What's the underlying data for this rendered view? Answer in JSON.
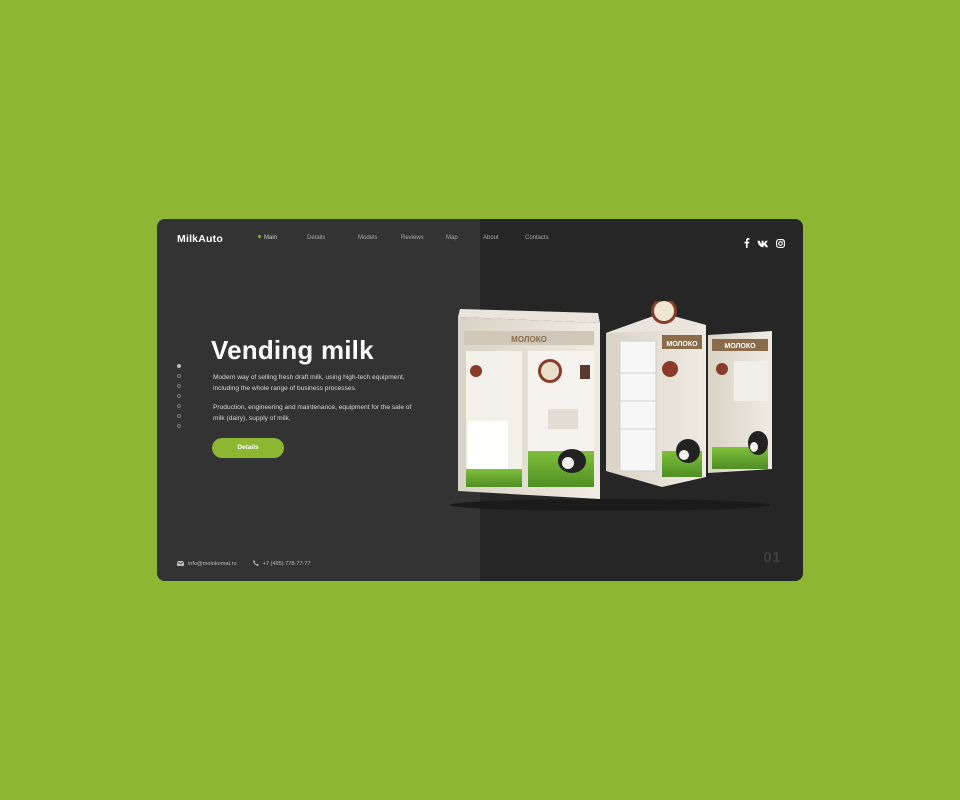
{
  "brand": {
    "logo": "MilkAuto"
  },
  "nav": {
    "items": [
      {
        "label": "Main",
        "active": true
      },
      {
        "label": "Details"
      },
      {
        "label": "Models"
      },
      {
        "label": "Reviews"
      },
      {
        "label": "Map"
      },
      {
        "label": "About"
      },
      {
        "label": "Contacts"
      }
    ]
  },
  "social": {
    "icons": [
      "facebook-icon",
      "vk-icon",
      "instagram-icon"
    ]
  },
  "slider": {
    "dot_count": 7,
    "active_index": 0,
    "current": "01"
  },
  "hero": {
    "title": "Vending milk",
    "paragraph1": "Modern way of selling fresh draft milk, using high-tech equipment, including the whole range of business processes.",
    "paragraph2": "Production, engineering and maintenance, equipment for the sale of milk (dairy), supply of milk.",
    "button_label": "Details"
  },
  "machines": {
    "left_label": "МОЛОКО",
    "center_label": "МОЛОКО",
    "right_label": "МОЛОКО"
  },
  "footer": {
    "email": "info@molokomat.ru",
    "phone": "+7 (495) 778-77-77"
  },
  "colors": {
    "accent": "#8db633",
    "background": "#8db633",
    "card_left": "#333333",
    "card_right": "#262626"
  }
}
